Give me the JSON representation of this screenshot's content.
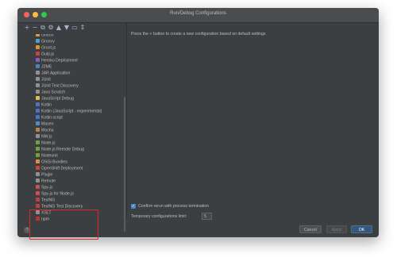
{
  "window": {
    "title": "Run/Debug Configurations"
  },
  "toolbar": [
    {
      "name": "add-icon",
      "glyph": "+"
    },
    {
      "name": "remove-icon",
      "glyph": "−"
    },
    {
      "name": "copy-icon",
      "glyph": "⧉"
    },
    {
      "name": "wrench-icon",
      "glyph": "⚙"
    },
    {
      "name": "move-up-icon",
      "glyph": "▲"
    },
    {
      "name": "move-down-icon",
      "glyph": "▼"
    },
    {
      "name": "folder-icon",
      "glyph": "▭"
    },
    {
      "name": "sort-icon",
      "glyph": "↕"
    }
  ],
  "tree_items": [
    {
      "label": "Griffon",
      "color": "#e0a030"
    },
    {
      "label": "Groovy",
      "color": "#4aa0d8"
    },
    {
      "label": "Grunt.js",
      "color": "#e09030"
    },
    {
      "label": "Gulp.js",
      "color": "#d04040"
    },
    {
      "label": "Heroku Deployment",
      "color": "#8060c0"
    },
    {
      "label": "J2ME",
      "color": "#5080c0"
    },
    {
      "label": "JAR Application",
      "color": "#909090"
    },
    {
      "label": "JUnit",
      "color": "#909090"
    },
    {
      "label": "JUnit Test Discovery",
      "color": "#909090"
    },
    {
      "label": "Java Scratch",
      "color": "#909090"
    },
    {
      "label": "JavaScript Debug",
      "color": "#e0c040"
    },
    {
      "label": "Kotlin",
      "color": "#5070d0"
    },
    {
      "label": "Kotlin (JavaScript - experimental)",
      "color": "#5070d0"
    },
    {
      "label": "Kotlin script",
      "color": "#5070d0"
    },
    {
      "label": "Maven",
      "color": "#4a90d0"
    },
    {
      "label": "Mocha",
      "color": "#c08040"
    },
    {
      "label": "NW.js",
      "color": "#909090"
    },
    {
      "label": "Node.js",
      "color": "#70a040"
    },
    {
      "label": "Node.js Remote Debug",
      "color": "#70a040"
    },
    {
      "label": "Nodeunit",
      "color": "#70a040"
    },
    {
      "label": "OSGi Bundles",
      "color": "#e09030"
    },
    {
      "label": "OpenShift Deployment",
      "color": "#d04040"
    },
    {
      "label": "Plugin",
      "color": "#909090"
    },
    {
      "label": "Remote",
      "color": "#909090"
    },
    {
      "label": "Spy-js",
      "color": "#d05050"
    },
    {
      "label": "Spy-js for Node.js",
      "color": "#d05050"
    },
    {
      "label": "TestNG",
      "color": "#c04040"
    },
    {
      "label": "TestNG Test Discovery",
      "color": "#c04040"
    },
    {
      "label": "XSLT",
      "color": "#909090"
    },
    {
      "label": "npm",
      "color": "#c03030"
    }
  ],
  "main": {
    "hint": "Press the + button to create a new configuration based on default settings",
    "confirm_rerun_label": "Confirm rerun with process termination",
    "confirm_rerun_checked": true,
    "temp_limit_label": "Temporary configurations limit:",
    "temp_limit_value": "5"
  },
  "footer": {
    "help_label": "?",
    "cancel_label": "Cancel",
    "apply_label": "Apply",
    "ok_label": "OK"
  }
}
